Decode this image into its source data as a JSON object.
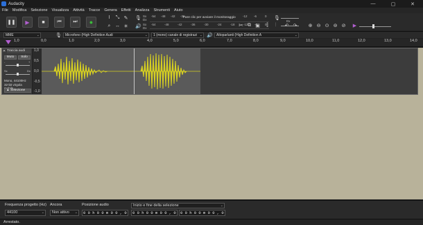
{
  "window": {
    "title": "Audacity",
    "minimize": "—",
    "maximize": "▢",
    "close": "✕"
  },
  "menu": [
    "File",
    "Modifica",
    "Selezione",
    "Visualizza",
    "Attività",
    "Tracce",
    "Genera",
    "Effetti",
    "Analizza",
    "Strumenti",
    "Aiuto"
  ],
  "transport": {
    "pause": "❚❚",
    "play": "▶",
    "stop": "■",
    "skip_start": "⏮",
    "skip_end": "⏭",
    "record": "●"
  },
  "meter": {
    "record_ticks": [
      "-54",
      "-48",
      "-42",
      "-36",
      "-30",
      "-24",
      "-18",
      "-12",
      "-6",
      "0"
    ],
    "record_message": "Fare clic per avviare il monitoraggio",
    "play_ticks": [
      "-54",
      "-48",
      "-42",
      "-36",
      "-30",
      "-24",
      "-18",
      "-12",
      "-6",
      "0"
    ],
    "record_channels": "Sx\nDx",
    "play_channels": "Sx\nDx"
  },
  "devices": {
    "host": "MME",
    "mic": "Microfono (High Definition Audi",
    "channels": "1 (mono) canale di registrazi",
    "speaker": "Altoparlanti (High Definition A"
  },
  "ruler": [
    "1,0",
    "0,0",
    "1,0",
    "2,0",
    "3,0",
    "4,0",
    "5,0",
    "6,0",
    "7,0",
    "8,0",
    "9,0",
    "10,0",
    "11,0",
    "12,0",
    "13,0",
    "14,0"
  ],
  "track": {
    "name": "Traccia audi",
    "mute": "Muto",
    "solo": "Solo",
    "gain_minus": "-",
    "gain_plus": "+",
    "pan_left": "Sx",
    "pan_right": "Dx",
    "info_line1": "Mono, 44100Hz",
    "info_line2": "32-bit virgola mobile",
    "select_button": "Selezione",
    "scale": [
      "1,0",
      "0,5",
      "0,0",
      "-0,5",
      "-1,0"
    ]
  },
  "status": {
    "rate_label": "Frequenza progetto (Hz)",
    "rate_value": "44100",
    "snap_label": "Ancora",
    "snap_value": "Non attivo",
    "pos_label": "Posizione audio",
    "pos_value": "0 0 h 0 0 m 0 0 , 0 0 0 s",
    "sel_label": "Inizio e fine della selezione",
    "sel_start": "0 0 h 0 0 m 0 0 , 0 0 0 s",
    "sel_end": "0 0 h 0 0 m 0 0 , 0 0 0 s",
    "message": "Arrestato."
  },
  "colors": {
    "waveform": "#d7d021",
    "record": "#3bbd3b",
    "play": "#b15ecf",
    "background": "#b8b29a"
  }
}
